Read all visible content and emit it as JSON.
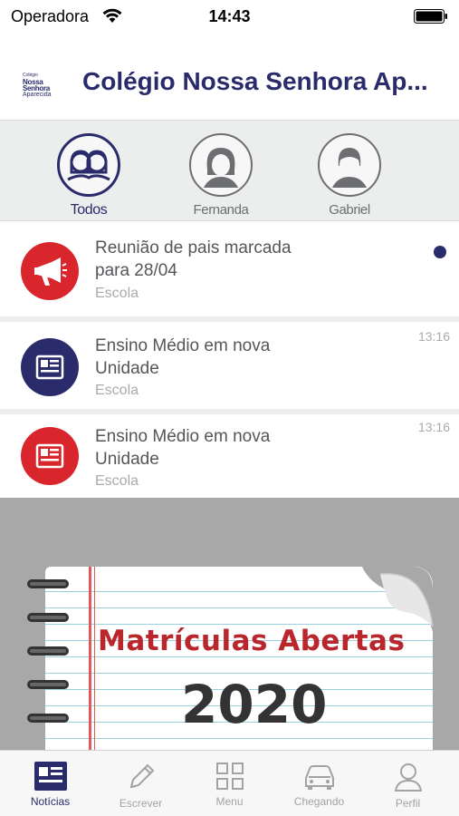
{
  "status": {
    "carrier": "Operadora",
    "time": "14:43"
  },
  "header": {
    "logo": {
      "line1": "Colégio",
      "line2": "Nossa Senhora",
      "line3": "Aparecida"
    },
    "title": "Colégio Nossa Senhora Ap..."
  },
  "filters": [
    {
      "label": "Todos",
      "active": true,
      "icon": "group-icon"
    },
    {
      "label": "Fernanda",
      "active": false,
      "icon": "female-avatar-icon"
    },
    {
      "label": "Gabriel",
      "active": false,
      "icon": "male-avatar-icon"
    }
  ],
  "news": [
    {
      "title_line1": "Reunião de pais marcada",
      "title_line2": "para 28/04",
      "category": "Escola",
      "time": "",
      "unread": true,
      "icon": "megaphone-icon",
      "color": "#d9262c"
    },
    {
      "title_line1": "Ensino Médio em nova",
      "title_line2": "Unidade",
      "category": "Escola",
      "time": "13:16",
      "unread": false,
      "icon": "newspaper-icon",
      "color": "#2a2b6b"
    },
    {
      "title_line1": "Ensino Médio em nova",
      "title_line2": "Unidade",
      "category": "Escola",
      "time": "13:16",
      "unread": false,
      "icon": "newspaper-icon",
      "color": "#d9262c"
    }
  ],
  "banner": {
    "title": "Matrículas Abertas",
    "year": "2020"
  },
  "tabs": [
    {
      "label": "Notícias",
      "active": true,
      "icon": "newspaper-icon"
    },
    {
      "label": "Escrever",
      "active": false,
      "icon": "pencil-icon"
    },
    {
      "label": "Menu",
      "active": false,
      "icon": "grid-icon"
    },
    {
      "label": "Chegando",
      "active": false,
      "icon": "car-icon"
    },
    {
      "label": "Perfil",
      "active": false,
      "icon": "person-icon"
    }
  ],
  "colors": {
    "brand": "#2a2b6b",
    "accent_red": "#d9262c",
    "muted_text": "#a9aaad"
  }
}
